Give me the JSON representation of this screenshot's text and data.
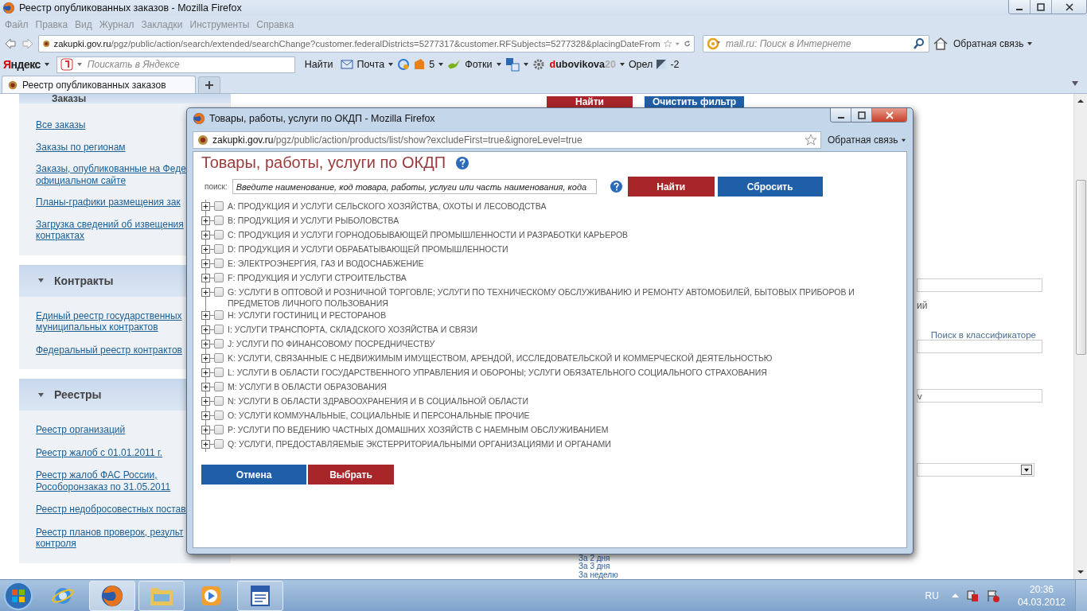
{
  "browser": {
    "title": "Реестр опубликованных заказов - Mozilla Firefox",
    "menu": [
      "Файл",
      "Правка",
      "Вид",
      "Журнал",
      "Закладки",
      "Инструменты",
      "Справка"
    ],
    "url": {
      "host": "zakupki.gov.ru",
      "path": "/pgz/public/action/search/extended/searchChange?customer.federalDistricts=5277317&customer.RFSubjects=5277328&placingDateFrom"
    },
    "search": {
      "placeholder": "mail.ru: Поиск в Интернете"
    },
    "feedback": "Обратная связь"
  },
  "yandex_bar": {
    "logo": "Яндекс",
    "search": {
      "placeholder": "Поискать в Яндексе"
    },
    "find": "Найти",
    "mail": "Почта",
    "counter": "5",
    "photos": "Фотки",
    "user": [
      {
        "text": "d",
        "kind": "accent"
      },
      {
        "text": "ubovikova",
        "kind": "main"
      },
      {
        "text": "20",
        "kind": "muted"
      }
    ],
    "city": "Орел",
    "temperature": "-2"
  },
  "tabs": [
    {
      "label": "Реестр опубликованных заказов",
      "selected": true
    }
  ],
  "sidebar": {
    "sections": [
      {
        "title": "Заказы",
        "links": [
          {
            "lines": [
              "Все заказы"
            ]
          },
          {
            "lines": [
              "Заказы по регионам"
            ]
          },
          {
            "lines": [
              "Заказы, опубликованные на Феде",
              "официальном сайте"
            ]
          },
          {
            "lines": [
              "Планы-графики размещения зак"
            ]
          },
          {
            "lines": [
              "Загрузка сведений об извещения",
              "контрактах"
            ]
          }
        ]
      },
      {
        "title": "Контракты",
        "links": [
          {
            "lines": [
              "Единый реестр государственных",
              "муниципальных контрактов"
            ]
          },
          {
            "lines": [
              "Федеральный реестр контрактов"
            ]
          }
        ]
      },
      {
        "title": "Реестры",
        "links": [
          {
            "lines": [
              "Реестр организаций"
            ]
          },
          {
            "lines": [
              "Реестр жалоб с 01.01.2011 г."
            ]
          },
          {
            "lines": [
              "Реестр жалоб ФАС России,",
              "Рособоронзаказ по 31.05.2011"
            ]
          },
          {
            "lines": [
              "Реестр недобросовестных постав"
            ]
          },
          {
            "lines": [
              "Реестр планов проверок, результ",
              "контроля"
            ]
          }
        ]
      }
    ]
  },
  "page": {
    "filter_buttons": [
      {
        "label": "Найти",
        "color": "#a8262a"
      },
      {
        "label": "Очистить фильтр",
        "color": "#1f5fa8"
      }
    ],
    "fragment": "ий",
    "classifier_link": "Поиск в классификаторе",
    "field_value": "v",
    "periods": [
      "За 2 дня",
      "За 3 дня",
      "За неделю"
    ]
  },
  "dialog": {
    "title": "Товары, работы, услуги по ОКДП - Mozilla Firefox",
    "url": {
      "host": "zakupki.gov.ru",
      "path": "/pgz/public/action/products/list/show?excludeFirst=true&ignoreLevel=true"
    },
    "feedback": "Обратная связь",
    "heading": "Товары, работы, услуги по ОКДП",
    "search": {
      "label": "поиск:",
      "placeholder": "Введите наименование, код товара, работы, услуги или часть наименования, кода"
    },
    "search_buttons": [
      {
        "label": "Найти",
        "color": "#a8262a"
      },
      {
        "label": "Сбросить",
        "color": "#1f5fa8"
      }
    ],
    "tree": [
      {
        "label": "A: ПРОДУКЦИЯ И УСЛУГИ СЕЛЬСКОГО ХОЗЯЙСТВА, ОХОТЫ И ЛЕСОВОДСТВА",
        "expanded": false,
        "checked": false
      },
      {
        "label": "B: ПРОДУКЦИЯ И УСЛУГИ РЫБОЛОВСТВА",
        "expanded": false,
        "checked": false
      },
      {
        "label": "C: ПРОДУКЦИЯ И УСЛУГИ ГОРНОДОБЫВАЮЩЕЙ ПРОМЫШЛЕННОСТИ И РАЗРАБОТКИ КАРЬЕРОВ",
        "expanded": false,
        "checked": false
      },
      {
        "label": "D: ПРОДУКЦИЯ И УСЛУГИ ОБРАБАТЫВАЮЩЕЙ ПРОМЫШЛЕННОСТИ",
        "expanded": false,
        "checked": false
      },
      {
        "label": "E: ЭЛЕКТРОЭНЕРГИЯ, ГАЗ И ВОДОСНАБЖЕНИЕ",
        "expanded": false,
        "checked": false
      },
      {
        "label": "F: ПРОДУКЦИЯ И УСЛУГИ СТРОИТЕЛЬСТВА",
        "expanded": false,
        "checked": false
      },
      {
        "label": "G: УСЛУГИ В ОПТОВОЙ И РОЗНИЧНОЙ ТОРГОВЛЕ; УСЛУГИ ПО ТЕХНИЧЕСКОМУ ОБСЛУЖИВАНИЮ И РЕМОНТУ АВТОМОБИЛЕЙ, БЫТОВЫХ ПРИБОРОВ И ПРЕДМЕТОВ ЛИЧНОГО ПОЛЬЗОВАНИЯ",
        "expanded": false,
        "checked": false
      },
      {
        "label": "H: УСЛУГИ ГОСТИНИЦ И РЕСТОРАНОВ",
        "expanded": false,
        "checked": false
      },
      {
        "label": "I: УСЛУГИ ТРАНСПОРТА, СКЛАДСКОГО ХОЗЯЙСТВА И СВЯЗИ",
        "expanded": false,
        "checked": false
      },
      {
        "label": "J: УСЛУГИ ПО ФИНАНСОВОМУ ПОСРЕДНИЧЕСТВУ",
        "expanded": false,
        "checked": false
      },
      {
        "label": "K: УСЛУГИ, СВЯЗАННЫЕ С НЕДВИЖИМЫМ ИМУЩЕСТВОМ, АРЕНДОЙ, ИССЛЕДОВАТЕЛЬСКОЙ И КОММЕРЧЕСКОЙ ДЕЯТЕЛЬНОСТЬЮ",
        "expanded": false,
        "checked": false
      },
      {
        "label": "L: УСЛУГИ В ОБЛАСТИ ГОСУДАРСТВЕННОГО УПРАВЛЕНИЯ И ОБОРОНЫ; УСЛУГИ ОБЯЗАТЕЛЬНОГО СОЦИАЛЬНОГО СТРАХОВАНИЯ",
        "expanded": false,
        "checked": false
      },
      {
        "label": "M: УСЛУГИ В ОБЛАСТИ ОБРАЗОВАНИЯ",
        "expanded": false,
        "checked": false
      },
      {
        "label": "N: УСЛУГИ В ОБЛАСТИ ЗДРАВООХРАНЕНИЯ И В СОЦИАЛЬНОЙ ОБЛАСТИ",
        "expanded": false,
        "checked": false
      },
      {
        "label": "O: УСЛУГИ КОММУНАЛЬНЫЕ, СОЦИАЛЬНЫЕ И ПЕРСОНАЛЬНЫЕ ПРОЧИЕ",
        "expanded": false,
        "checked": false
      },
      {
        "label": "P: УСЛУГИ ПО ВЕДЕНИЮ ЧАСТНЫХ ДОМАШНИХ ХОЗЯЙСТВ С НАЕМНЫМ ОБСЛУЖИВАНИЕМ",
        "expanded": false,
        "checked": false
      },
      {
        "label": "Q: УСЛУГИ, ПРЕДОСТАВЛЯЕМЫЕ ЭКСТЕРРИТОРИАЛЬНЫМИ ОРГАНИЗАЦИЯМИ И ОРГАНАМИ",
        "expanded": false,
        "checked": false
      }
    ],
    "buttons": [
      {
        "label": "Отмена",
        "color": "#1f5fa8"
      },
      {
        "label": "Выбрать",
        "color": "#a8262a"
      }
    ]
  },
  "taskbar": {
    "apps": [
      {
        "kind": "ie",
        "running": false,
        "active": false
      },
      {
        "kind": "firefox",
        "running": true,
        "active": true
      },
      {
        "kind": "explorer",
        "running": true,
        "active": false
      },
      {
        "kind": "media",
        "running": false,
        "active": false
      },
      {
        "kind": "word",
        "running": true,
        "active": false
      }
    ],
    "language": "RU",
    "time": "20:36",
    "date": "04.03.2012"
  }
}
